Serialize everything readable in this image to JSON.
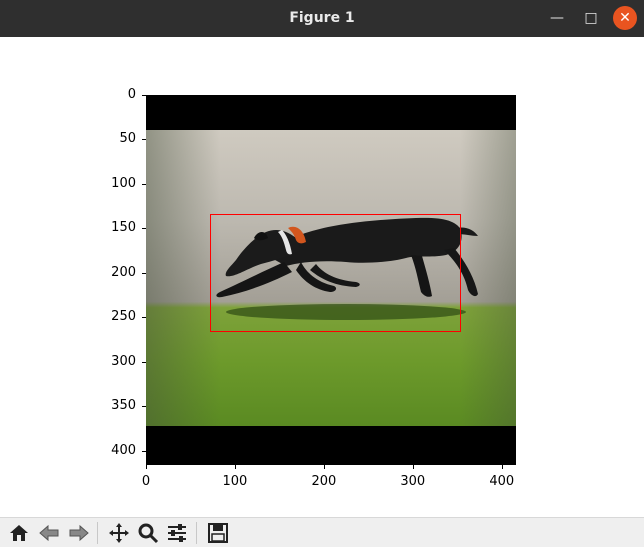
{
  "window": {
    "title": "Figure 1",
    "controls": {
      "minimize": "minimize-icon",
      "maximize": "maximize-icon",
      "close": "close-icon"
    }
  },
  "figure": {
    "axes": {
      "x_ticks": [
        "0",
        "100",
        "200",
        "300",
        "400"
      ],
      "y_ticks": [
        "0",
        "50",
        "100",
        "150",
        "200",
        "250",
        "300",
        "350",
        "400"
      ]
    },
    "image": {
      "subject": "black dog running on grass in front of a wall"
    },
    "bounding_box": {
      "x_min": 72,
      "y_min": 134,
      "x_max": 354,
      "y_max": 266,
      "color": "#ff0000"
    },
    "image_size": 416
  },
  "toolbar": {
    "icons": [
      "home-icon",
      "back-icon",
      "forward-icon",
      "pan-icon",
      "zoom-icon",
      "configure-subplots-icon",
      "save-icon"
    ]
  }
}
